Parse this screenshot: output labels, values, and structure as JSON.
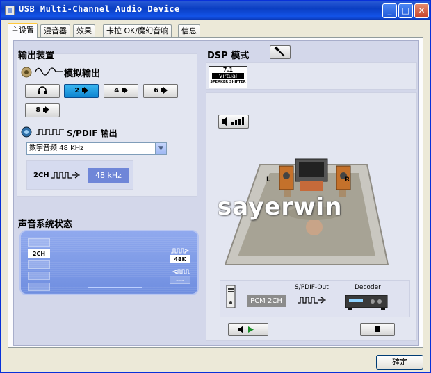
{
  "window": {
    "title": "USB Multi-Channel Audio Device",
    "minimize_label": "_",
    "maximize_label": "□",
    "close_label": "✕"
  },
  "tabs": [
    {
      "label": "主设置",
      "active": true
    },
    {
      "label": "混音器",
      "active": false
    },
    {
      "label": "效果",
      "active": false
    },
    {
      "label": "卡拉 OK/魔幻音响",
      "active": false
    },
    {
      "label": "信息",
      "active": false
    }
  ],
  "output": {
    "heading": "输出装置",
    "analog_label": "模拟输出",
    "channel_buttons": [
      {
        "label": "",
        "icon": "headphone-icon",
        "selected": false
      },
      {
        "label": "2",
        "icon": "speaker-icon",
        "selected": true
      },
      {
        "label": "4",
        "icon": "speaker-icon",
        "selected": false
      },
      {
        "label": "6",
        "icon": "speaker-icon",
        "selected": false
      },
      {
        "label": "8",
        "icon": "speaker-icon",
        "selected": false
      }
    ],
    "spdif_label": "S/PDIF 输出",
    "spdif_select_value": "数字音频 48 KHz",
    "spdif_channel": "2CH",
    "spdif_rate": "48 kHz"
  },
  "status": {
    "heading": "声音系统状态",
    "channel_tags": [
      "",
      "2CH",
      "",
      "",
      ""
    ],
    "sample_rate": "48K",
    "input_rate": "----"
  },
  "dsp": {
    "heading": "DSP 模式",
    "badge_top": "7.1",
    "badge_mid": "Virtual",
    "badge_bottom": "SPEAKER SHIFTER",
    "left_label": "L",
    "right_label": "R",
    "watermark": "sayerwin",
    "chain_format": "PCM 2CH",
    "chain_spdif_label": "S/PDIF-Out",
    "chain_decoder_label": "Decoder"
  },
  "footer": {
    "ok_label": "確定"
  },
  "colors": {
    "title_bar": "#0a3ec2",
    "selected_button": "#0d84d0",
    "status_panel": "#6f8ee0",
    "rate_box": "#6f86d8"
  }
}
